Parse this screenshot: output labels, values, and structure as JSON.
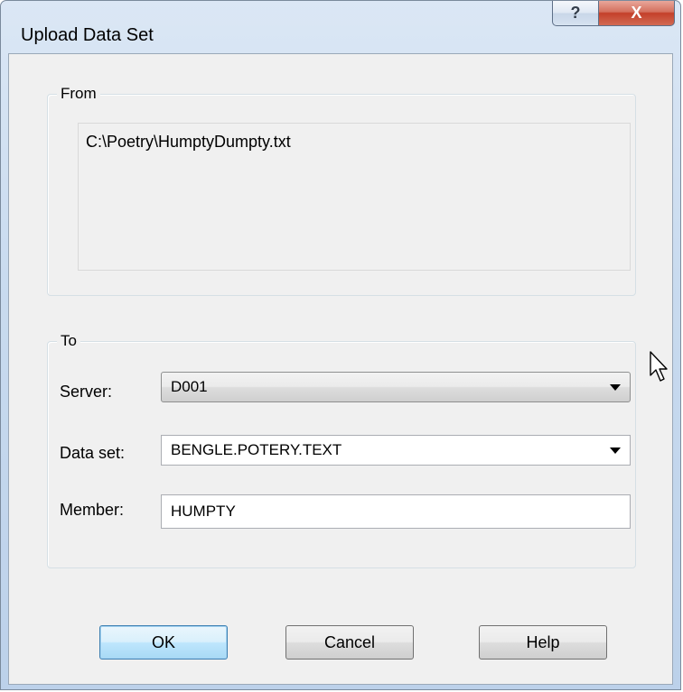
{
  "window": {
    "title": "Upload Data Set",
    "help_glyph": "?",
    "close_glyph": "X"
  },
  "from_group": {
    "legend": "From",
    "path": "C:\\Poetry\\HumptyDumpty.txt"
  },
  "to_group": {
    "legend": "To",
    "server_label": "Server:",
    "server_value": "D001",
    "dataset_label": "Data set:",
    "dataset_value": "BENGLE.POTERY.TEXT",
    "member_label": "Member:",
    "member_value": "HUMPTY"
  },
  "buttons": {
    "ok": "OK",
    "cancel": "Cancel",
    "help": "Help"
  },
  "icons": {
    "help": "question-mark-icon",
    "close": "close-x-icon",
    "dropdown": "chevron-down-icon",
    "cursor": "mouse-pointer-icon"
  }
}
